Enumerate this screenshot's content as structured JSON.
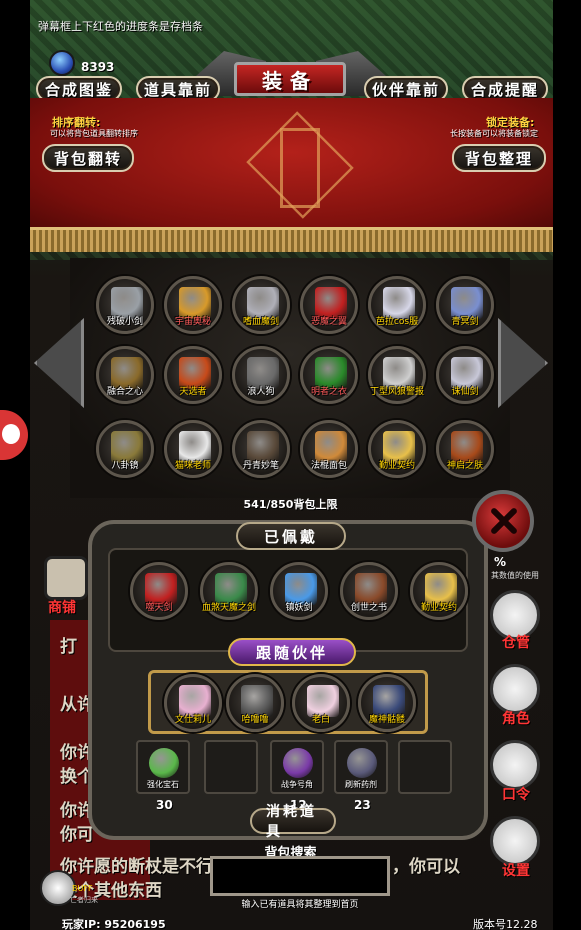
{
  "header": {
    "hint": "弹幕框上下红色的进度条是存档条",
    "coins": "8393",
    "title": "装备",
    "tabs": [
      "合成图鉴",
      "道具靠前",
      "伙伴靠前",
      "合成提醒"
    ]
  },
  "banner": {
    "left_label": "排序翻转:",
    "left_sub": "可以将背包道具翻转排序",
    "right_label": "锁定装备:",
    "right_sub": "长按装备可以将装备锁定",
    "flip_button": "背包翻转",
    "sort_button": "背包整理"
  },
  "bag": {
    "items": [
      {
        "name": "残破小剑",
        "color": "#9aa0a6",
        "tone": ""
      },
      {
        "name": "宇宙奥秘",
        "color": "#d89a2a",
        "tone": "rd"
      },
      {
        "name": "嗜血魔剑",
        "color": "#b0b0b8",
        "tone": "yl"
      },
      {
        "name": "恶魔之翼",
        "color": "#c22020",
        "tone": "rd"
      },
      {
        "name": "芭拉cos服",
        "color": "#d7d7e8",
        "tone": "yl"
      },
      {
        "name": "青冥剑",
        "color": "#7a8fd0",
        "tone": "yl"
      },
      {
        "name": "融合之心",
        "color": "#8a6a2a",
        "tone": ""
      },
      {
        "name": "天选者",
        "color": "#c74a1a",
        "tone": "yl"
      },
      {
        "name": "浪人狗",
        "color": "#6a6a6a",
        "tone": ""
      },
      {
        "name": "明者之衣",
        "color": "#2a8a2a",
        "tone": "rd"
      },
      {
        "name": "丁型风狼警报",
        "color": "#cfcfcf",
        "tone": "yl"
      },
      {
        "name": "诛仙剑",
        "color": "#c8c8d8",
        "tone": "yl"
      },
      {
        "name": "八卦镜",
        "color": "#8a7a3a",
        "tone": ""
      },
      {
        "name": "猫咪老师",
        "color": "#e8e8e8",
        "tone": "yl"
      },
      {
        "name": "丹青妙笔",
        "color": "#5a4a3a",
        "tone": ""
      },
      {
        "name": "法棍面包",
        "color": "#d08a3a",
        "tone": ""
      },
      {
        "name": "勤业契约",
        "color": "#e8c04a",
        "tone": "yl"
      },
      {
        "name": "神启之肤",
        "color": "#a84a1a",
        "tone": "yl"
      }
    ],
    "count": "541/850背包上限"
  },
  "equipped": {
    "title": "已佩戴",
    "items": [
      {
        "name": "噬天剑",
        "color": "#c22020",
        "tone": "rd"
      },
      {
        "name": "血煞天魔之剑",
        "color": "#3a8a4a",
        "tone": "yl"
      },
      {
        "name": "镇妖剑",
        "color": "#4a9ae8",
        "tone": ""
      },
      {
        "name": "创世之书",
        "color": "#8a4a2a",
        "tone": ""
      },
      {
        "name": "勤业契约",
        "color": "#e8c04a",
        "tone": "yl"
      }
    ]
  },
  "partners": {
    "title": "跟随伙伴",
    "items": [
      {
        "name": "文仕莉儿",
        "color": "#e8b0d0"
      },
      {
        "name": "哈噜噜",
        "color": "#5a5a5a"
      },
      {
        "name": "老白",
        "color": "#f0d0e0"
      },
      {
        "name": "魔神骷髅",
        "color": "#3a4a7a"
      }
    ]
  },
  "consumables": {
    "title": "消耗道具",
    "items": [
      {
        "name": "强化宝石",
        "qty": "30",
        "color": "#5ab84a"
      },
      {
        "name": "",
        "qty": "",
        "color": ""
      },
      {
        "name": "战争号角",
        "qty": "12",
        "color": "#7a3aa8"
      },
      {
        "name": "刷新药剂",
        "qty": "23",
        "color": "#5a5a7a"
      },
      {
        "name": "",
        "qty": "",
        "color": ""
      }
    ]
  },
  "search": {
    "label": "背包搜索",
    "hint": "输入已有道具将其整理到首页"
  },
  "side_menu": {
    "shop": "商铺",
    "manage": "仓管",
    "role": "角色",
    "password": "口令",
    "settings": "设置",
    "percent": "%",
    "stat": "其数值的使用"
  },
  "story": {
    "line1": "打",
    "line2": "从许",
    "line3": "你许",
    "line4": "换个",
    "line5": "你许",
    "line6": "你可",
    "line7": "你许愿的断杖是不行",
    "line8": "，你可以",
    "line9": "换个其他东西"
  },
  "footer": {
    "buff": "BUFF",
    "buff_sub": "亡者归来",
    "player_ip": "玩家IP: 95206195",
    "version": "版本号12.28"
  }
}
